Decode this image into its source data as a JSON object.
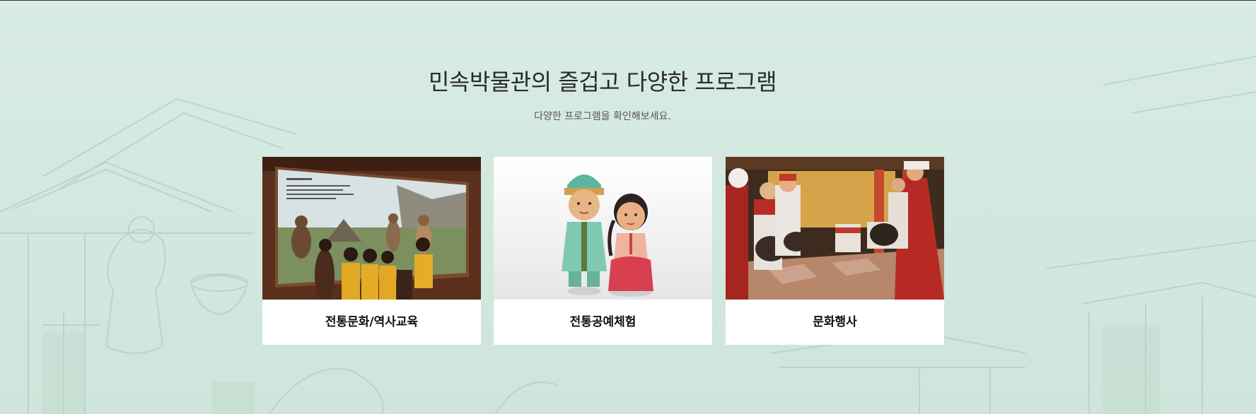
{
  "section": {
    "title": "민속박물관의 즐겁고 다양한 프로그램",
    "subtitle": "다양한 프로그램을 확인해보세요."
  },
  "cards": [
    {
      "label": "전통문화/역사교육",
      "image": "museum-education-photo"
    },
    {
      "label": "전통공예체험",
      "image": "clay-dolls-photo"
    },
    {
      "label": "문화행사",
      "image": "performance-photo"
    }
  ],
  "colors": {
    "background": "#d5eae1",
    "card": "#ffffff",
    "title_text": "#2a2a2a"
  }
}
